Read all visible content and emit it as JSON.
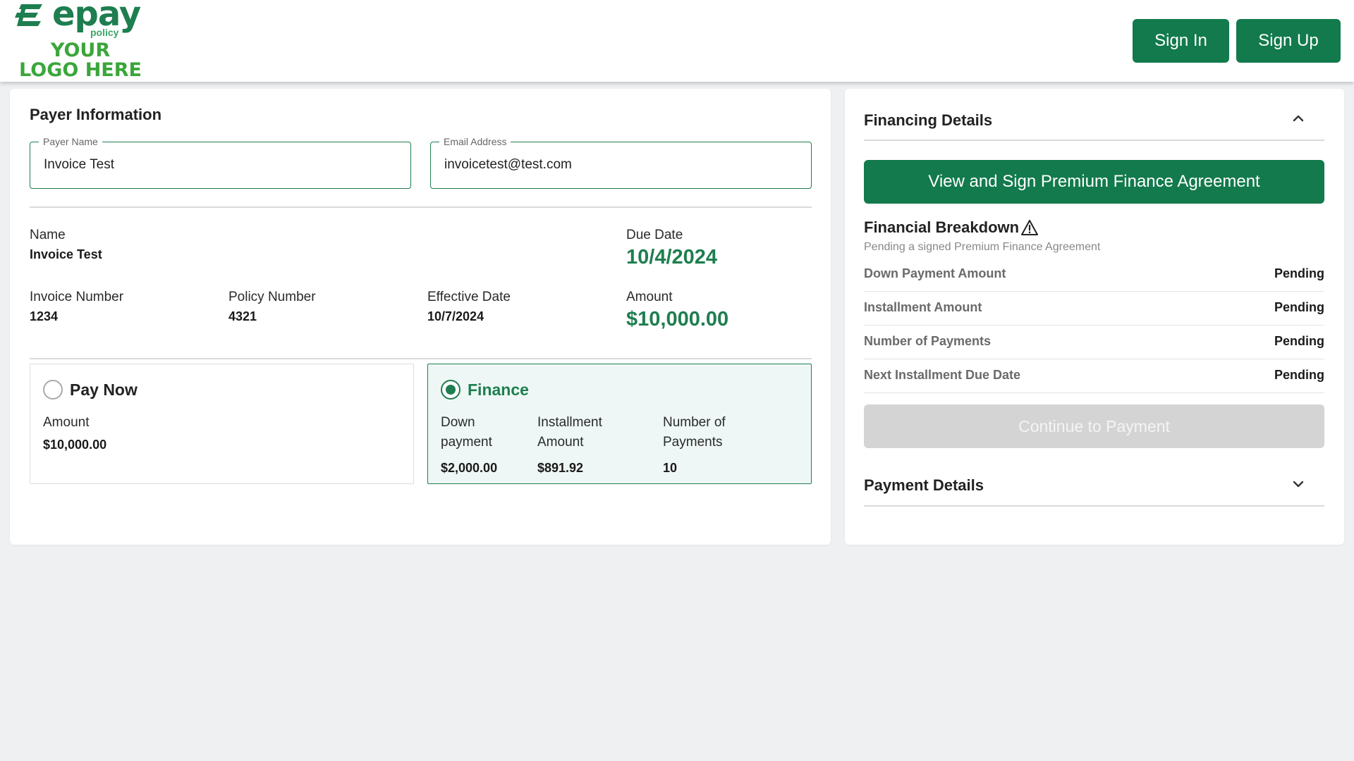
{
  "header": {
    "brand": "epay",
    "brand_sub": "policy",
    "logo_placeholder": "YOUR LOGO HERE",
    "sign_in_label": "Sign In",
    "sign_up_label": "Sign Up"
  },
  "payer": {
    "title": "Payer Information",
    "name_field": {
      "label": "Payer Name",
      "value": "Invoice Test"
    },
    "email_field": {
      "label": "Email Address",
      "value": "invoicetest@test.com"
    }
  },
  "invoice": {
    "name_label": "Name",
    "name_value": "Invoice Test",
    "due_date_label": "Due Date",
    "due_date_value": "10/4/2024",
    "invoice_number_label": "Invoice Number",
    "invoice_number_value": "1234",
    "policy_number_label": "Policy Number",
    "policy_number_value": "4321",
    "effective_date_label": "Effective Date",
    "effective_date_value": "10/7/2024",
    "amount_label": "Amount",
    "amount_value": "$10,000.00"
  },
  "options": {
    "pay_now": {
      "title": "Pay Now",
      "selected": false,
      "amount_label": "Amount",
      "amount_value": "$10,000.00"
    },
    "finance": {
      "title": "Finance",
      "selected": true,
      "down_payment_label_1": "Down",
      "down_payment_label_2": "payment",
      "down_payment_value": "$2,000.00",
      "installment_label_1": "Installment",
      "installment_label_2": "Amount",
      "installment_value": "$891.92",
      "payments_label_1": "Number of",
      "payments_label_2": "Payments",
      "payments_value": "10"
    }
  },
  "financing": {
    "title": "Financing Details",
    "agreement_button": "View and Sign Premium Finance Agreement",
    "breakdown_title": "Financial Breakdown",
    "breakdown_subtitle": "Pending a signed Premium Finance Agreement",
    "rows": [
      {
        "label": "Down Payment Amount",
        "value": "Pending"
      },
      {
        "label": "Installment Amount",
        "value": "Pending"
      },
      {
        "label": "Number of Payments",
        "value": "Pending"
      },
      {
        "label": "Next Installment Due Date",
        "value": "Pending"
      }
    ],
    "continue_button": "Continue to Payment"
  },
  "payment_details": {
    "title": "Payment Details"
  },
  "colors": {
    "brand_green": "#127a4c",
    "accent_green": "#1e7e4f",
    "logo_green": "#3aa63a",
    "page_bg": "#eff0f2",
    "disabled_button": "#d4d4d4"
  },
  "icons": {
    "logo": "epay-logo-mark",
    "financing_toggle": "chevron-up-icon",
    "payment_toggle": "chevron-down-icon",
    "breakdown_warning": "warning-icon"
  }
}
